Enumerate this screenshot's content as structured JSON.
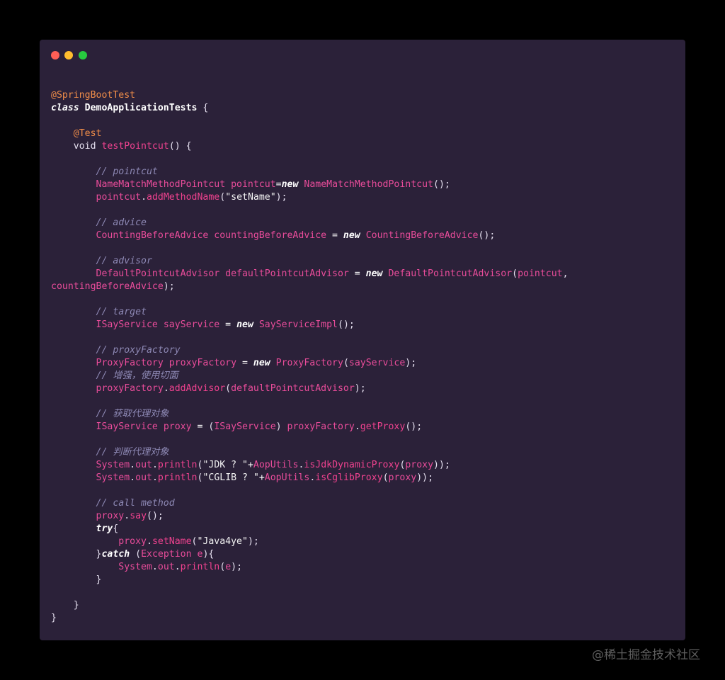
{
  "window": {
    "buttons": [
      {
        "name": "close",
        "color": "#ff5f56"
      },
      {
        "name": "minimize",
        "color": "#ffbd2e"
      },
      {
        "name": "maximize",
        "color": "#27c93f"
      }
    ]
  },
  "colors": {
    "background": "#000000",
    "editor": "#2b2139",
    "annotation": "#f08d49",
    "identifier": "#e94c9a",
    "comment": "#8d88b4",
    "keyword": "#ffffff"
  },
  "code_lines": [
    [
      {
        "t": "@SpringBootTest",
        "c": "ann"
      }
    ],
    [
      {
        "t": "class",
        "c": "kw"
      },
      {
        "t": " ",
        "c": "pl"
      },
      {
        "t": "DemoApplicationTests",
        "c": "cls"
      },
      {
        "t": " {",
        "c": "pl"
      }
    ],
    [],
    [
      {
        "t": "    ",
        "c": "pl"
      },
      {
        "t": "@Test",
        "c": "ann"
      }
    ],
    [
      {
        "t": "    void ",
        "c": "pl"
      },
      {
        "t": "testPointcut",
        "c": "fn"
      },
      {
        "t": "() {",
        "c": "pl"
      }
    ],
    [],
    [
      {
        "t": "        ",
        "c": "pl"
      },
      {
        "t": "// pointcut",
        "c": "cm"
      }
    ],
    [
      {
        "t": "        ",
        "c": "pl"
      },
      {
        "t": "NameMatchMethodPointcut",
        "c": "ty"
      },
      {
        "t": " ",
        "c": "pl"
      },
      {
        "t": "pointcut",
        "c": "var"
      },
      {
        "t": "=",
        "c": "op"
      },
      {
        "t": "new",
        "c": "kw"
      },
      {
        "t": " ",
        "c": "pl"
      },
      {
        "t": "NameMatchMethodPointcut",
        "c": "ty"
      },
      {
        "t": "();",
        "c": "pl"
      }
    ],
    [
      {
        "t": "        ",
        "c": "pl"
      },
      {
        "t": "pointcut",
        "c": "var"
      },
      {
        "t": ".",
        "c": "pl"
      },
      {
        "t": "addMethodName",
        "c": "fn"
      },
      {
        "t": "(",
        "c": "pl"
      },
      {
        "t": "\"setName\"",
        "c": "str"
      },
      {
        "t": ");",
        "c": "pl"
      }
    ],
    [],
    [
      {
        "t": "        ",
        "c": "pl"
      },
      {
        "t": "// advice",
        "c": "cm"
      }
    ],
    [
      {
        "t": "        ",
        "c": "pl"
      },
      {
        "t": "CountingBeforeAdvice",
        "c": "ty"
      },
      {
        "t": " ",
        "c": "pl"
      },
      {
        "t": "countingBeforeAdvice",
        "c": "var"
      },
      {
        "t": " = ",
        "c": "op"
      },
      {
        "t": "new",
        "c": "kw"
      },
      {
        "t": " ",
        "c": "pl"
      },
      {
        "t": "CountingBeforeAdvice",
        "c": "ty"
      },
      {
        "t": "();",
        "c": "pl"
      }
    ],
    [],
    [
      {
        "t": "        ",
        "c": "pl"
      },
      {
        "t": "// advisor",
        "c": "cm"
      }
    ],
    [
      {
        "t": "        ",
        "c": "pl"
      },
      {
        "t": "DefaultPointcutAdvisor",
        "c": "ty"
      },
      {
        "t": " ",
        "c": "pl"
      },
      {
        "t": "defaultPointcutAdvisor",
        "c": "var"
      },
      {
        "t": " = ",
        "c": "op"
      },
      {
        "t": "new",
        "c": "kw"
      },
      {
        "t": " ",
        "c": "pl"
      },
      {
        "t": "DefaultPointcutAdvisor",
        "c": "ty"
      },
      {
        "t": "(",
        "c": "pl"
      },
      {
        "t": "pointcut",
        "c": "var"
      },
      {
        "t": ",",
        "c": "pl"
      }
    ],
    [
      {
        "t": "countingBeforeAdvice",
        "c": "var"
      },
      {
        "t": ");",
        "c": "pl"
      }
    ],
    [],
    [
      {
        "t": "        ",
        "c": "pl"
      },
      {
        "t": "// target",
        "c": "cm"
      }
    ],
    [
      {
        "t": "        ",
        "c": "pl"
      },
      {
        "t": "ISayService",
        "c": "ty"
      },
      {
        "t": " ",
        "c": "pl"
      },
      {
        "t": "sayService",
        "c": "var"
      },
      {
        "t": " = ",
        "c": "op"
      },
      {
        "t": "new",
        "c": "kw"
      },
      {
        "t": " ",
        "c": "pl"
      },
      {
        "t": "SayServiceImpl",
        "c": "ty"
      },
      {
        "t": "();",
        "c": "pl"
      }
    ],
    [],
    [
      {
        "t": "        ",
        "c": "pl"
      },
      {
        "t": "// proxyFactory",
        "c": "cm"
      }
    ],
    [
      {
        "t": "        ",
        "c": "pl"
      },
      {
        "t": "ProxyFactory",
        "c": "ty"
      },
      {
        "t": " ",
        "c": "pl"
      },
      {
        "t": "proxyFactory",
        "c": "var"
      },
      {
        "t": " = ",
        "c": "op"
      },
      {
        "t": "new",
        "c": "kw"
      },
      {
        "t": " ",
        "c": "pl"
      },
      {
        "t": "ProxyFactory",
        "c": "ty"
      },
      {
        "t": "(",
        "c": "pl"
      },
      {
        "t": "sayService",
        "c": "var"
      },
      {
        "t": ");",
        "c": "pl"
      }
    ],
    [
      {
        "t": "        ",
        "c": "pl"
      },
      {
        "t": "// 增强，使用切面",
        "c": "cm"
      }
    ],
    [
      {
        "t": "        ",
        "c": "pl"
      },
      {
        "t": "proxyFactory",
        "c": "var"
      },
      {
        "t": ".",
        "c": "pl"
      },
      {
        "t": "addAdvisor",
        "c": "fn"
      },
      {
        "t": "(",
        "c": "pl"
      },
      {
        "t": "defaultPointcutAdvisor",
        "c": "var"
      },
      {
        "t": ");",
        "c": "pl"
      }
    ],
    [],
    [
      {
        "t": "        ",
        "c": "pl"
      },
      {
        "t": "// 获取代理对象",
        "c": "cm"
      }
    ],
    [
      {
        "t": "        ",
        "c": "pl"
      },
      {
        "t": "ISayService",
        "c": "ty"
      },
      {
        "t": " ",
        "c": "pl"
      },
      {
        "t": "proxy",
        "c": "var"
      },
      {
        "t": " = ",
        "c": "op"
      },
      {
        "t": "(",
        "c": "pl"
      },
      {
        "t": "ISayService",
        "c": "ty"
      },
      {
        "t": ") ",
        "c": "pl"
      },
      {
        "t": "proxyFactory",
        "c": "var"
      },
      {
        "t": ".",
        "c": "pl"
      },
      {
        "t": "getProxy",
        "c": "fn"
      },
      {
        "t": "();",
        "c": "pl"
      }
    ],
    [],
    [
      {
        "t": "        ",
        "c": "pl"
      },
      {
        "t": "// 判断代理对象",
        "c": "cm"
      }
    ],
    [
      {
        "t": "        ",
        "c": "pl"
      },
      {
        "t": "System",
        "c": "ty"
      },
      {
        "t": ".",
        "c": "pl"
      },
      {
        "t": "out",
        "c": "var"
      },
      {
        "t": ".",
        "c": "pl"
      },
      {
        "t": "println",
        "c": "fn"
      },
      {
        "t": "(",
        "c": "pl"
      },
      {
        "t": "\"JDK ? \"",
        "c": "str"
      },
      {
        "t": "+",
        "c": "op"
      },
      {
        "t": "AopUtils",
        "c": "ty"
      },
      {
        "t": ".",
        "c": "pl"
      },
      {
        "t": "isJdkDynamicProxy",
        "c": "fn"
      },
      {
        "t": "(",
        "c": "pl"
      },
      {
        "t": "proxy",
        "c": "var"
      },
      {
        "t": "));",
        "c": "pl"
      }
    ],
    [
      {
        "t": "        ",
        "c": "pl"
      },
      {
        "t": "System",
        "c": "ty"
      },
      {
        "t": ".",
        "c": "pl"
      },
      {
        "t": "out",
        "c": "var"
      },
      {
        "t": ".",
        "c": "pl"
      },
      {
        "t": "println",
        "c": "fn"
      },
      {
        "t": "(",
        "c": "pl"
      },
      {
        "t": "\"CGLIB ? \"",
        "c": "str"
      },
      {
        "t": "+",
        "c": "op"
      },
      {
        "t": "AopUtils",
        "c": "ty"
      },
      {
        "t": ".",
        "c": "pl"
      },
      {
        "t": "isCglibProxy",
        "c": "fn"
      },
      {
        "t": "(",
        "c": "pl"
      },
      {
        "t": "proxy",
        "c": "var"
      },
      {
        "t": "));",
        "c": "pl"
      }
    ],
    [],
    [
      {
        "t": "        ",
        "c": "pl"
      },
      {
        "t": "// call method",
        "c": "cm"
      }
    ],
    [
      {
        "t": "        ",
        "c": "pl"
      },
      {
        "t": "proxy",
        "c": "var"
      },
      {
        "t": ".",
        "c": "pl"
      },
      {
        "t": "say",
        "c": "fn"
      },
      {
        "t": "();",
        "c": "pl"
      }
    ],
    [
      {
        "t": "        ",
        "c": "pl"
      },
      {
        "t": "try",
        "c": "kw"
      },
      {
        "t": "{",
        "c": "pl"
      }
    ],
    [
      {
        "t": "            ",
        "c": "pl"
      },
      {
        "t": "proxy",
        "c": "var"
      },
      {
        "t": ".",
        "c": "pl"
      },
      {
        "t": "setName",
        "c": "fn"
      },
      {
        "t": "(",
        "c": "pl"
      },
      {
        "t": "\"Java4ye\"",
        "c": "str"
      },
      {
        "t": ");",
        "c": "pl"
      }
    ],
    [
      {
        "t": "        }",
        "c": "pl"
      },
      {
        "t": "catch",
        "c": "kw"
      },
      {
        "t": " (",
        "c": "pl"
      },
      {
        "t": "Exception",
        "c": "ty"
      },
      {
        "t": " ",
        "c": "pl"
      },
      {
        "t": "e",
        "c": "var"
      },
      {
        "t": "){",
        "c": "pl"
      }
    ],
    [
      {
        "t": "            ",
        "c": "pl"
      },
      {
        "t": "System",
        "c": "ty"
      },
      {
        "t": ".",
        "c": "pl"
      },
      {
        "t": "out",
        "c": "var"
      },
      {
        "t": ".",
        "c": "pl"
      },
      {
        "t": "println",
        "c": "fn"
      },
      {
        "t": "(",
        "c": "pl"
      },
      {
        "t": "e",
        "c": "var"
      },
      {
        "t": ");",
        "c": "pl"
      }
    ],
    [
      {
        "t": "        }",
        "c": "pl"
      }
    ],
    [],
    [
      {
        "t": "    }",
        "c": "pl"
      }
    ],
    [
      {
        "t": "}",
        "c": "pl"
      }
    ]
  ],
  "watermark": "@稀土掘金技术社区"
}
